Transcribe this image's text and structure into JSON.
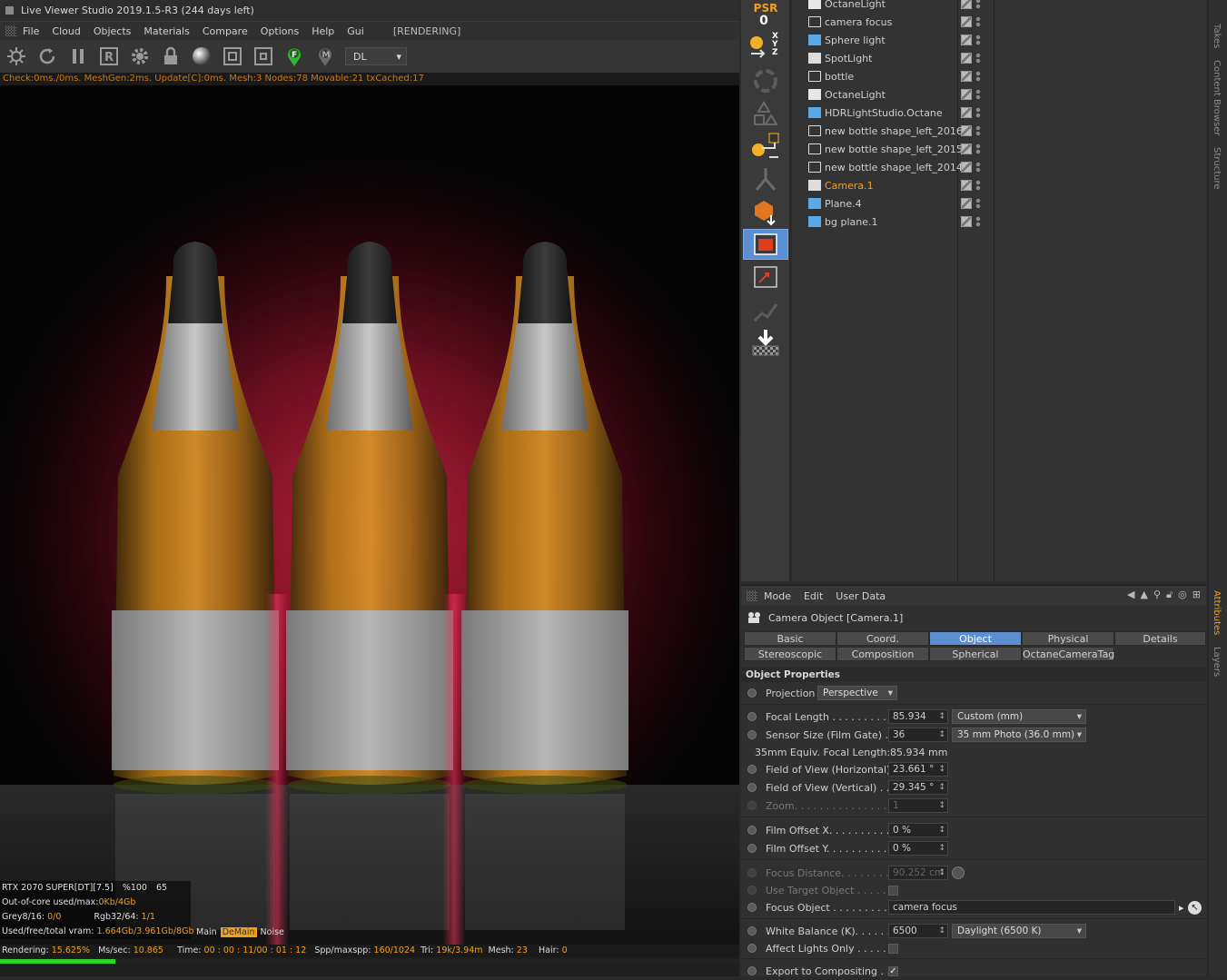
{
  "viewer": {
    "title": "Live Viewer Studio 2019.1.5-R3 (244 days left)",
    "menu": [
      "File",
      "Cloud",
      "Objects",
      "Materials",
      "Compare",
      "Options",
      "Help",
      "Gui"
    ],
    "status": "[RENDERING]",
    "kernel": "DL",
    "check_line": "Check:0ms./0ms. MeshGen:2ms. Update[C]:0ms. Mesh:3 Nodes:78 Movable:21 txCached:17",
    "hud": {
      "gpu": "RTX 2070 SUPER[DT][7.5]",
      "pct": "%100",
      "temp": "65",
      "ooc_label": "Out-of-core used/max:",
      "ooc_value": "0Kb/4Gb",
      "grey_label": "Grey8/16:",
      "grey_value": "0/0",
      "rgb_label": "Rgb32/64:",
      "rgb_value": "1/1",
      "vram_label": "Used/free/total vram:",
      "vram_value": "1.664Gb/3.961Gb/8Gb"
    },
    "channels": [
      "Main",
      "DeMain",
      "Noise"
    ],
    "render_stats": {
      "rendering_label": "Rendering:",
      "rendering_value": "15.625%",
      "ms_label": "Ms/sec:",
      "ms_value": "10.865",
      "time_label": "Time:",
      "time_value": "00 : 00 : 11/00 : 01 : 12",
      "spp_label": "Spp/maxspp:",
      "spp_value": "160/1024",
      "tri_label": "Tri:",
      "tri_value": "19k/3.94m",
      "mesh_label": "Mesh:",
      "mesh_value": "23",
      "hair_label": "Hair:",
      "hair_value": "0"
    },
    "progress": 0.15625
  },
  "palette": {
    "psr_label": "PSR",
    "psr_value": "0",
    "axes": [
      "X",
      "Y",
      "Z"
    ]
  },
  "objects": [
    {
      "name": "OctaneLight",
      "selected": false
    },
    {
      "name": "camera focus",
      "selected": false
    },
    {
      "name": "Sphere light",
      "selected": false
    },
    {
      "name": "SpotLight",
      "selected": false
    },
    {
      "name": "bottle",
      "selected": false
    },
    {
      "name": "OctaneLight",
      "selected": false
    },
    {
      "name": "HDRLightStudio.Octane",
      "selected": false
    },
    {
      "name": "new bottle shape_left_2016",
      "selected": false
    },
    {
      "name": "new bottle shape_left_2015",
      "selected": false
    },
    {
      "name": "new bottle shape_left_2014",
      "selected": false
    },
    {
      "name": "Camera.1",
      "selected": true
    },
    {
      "name": "Plane.4",
      "selected": false
    },
    {
      "name": "bg plane.1",
      "selected": false
    }
  ],
  "side_tabs": [
    "Takes",
    "Content Browser",
    "Structure",
    "Attributes",
    "Layers"
  ],
  "attributes": {
    "menu": [
      "Mode",
      "Edit",
      "User Data"
    ],
    "title": "Camera Object [Camera.1]",
    "tabs_row1": [
      "Basic",
      "Coord.",
      "Object",
      "Physical",
      "Details"
    ],
    "tabs_row2": [
      "Stereoscopic",
      "Composition",
      "Spherical",
      "OctaneCameraTag"
    ],
    "active_tab": "Object",
    "section": "Object Properties",
    "projection_label": "Projection",
    "projection_value": "Perspective",
    "focal_label": "Focal Length . . . . . . . . . . .",
    "focal_value": "85.934",
    "focal_preset": "Custom (mm)",
    "sensor_label": "Sensor Size (Film Gate) . .",
    "sensor_value": "36",
    "sensor_preset": "35 mm Photo (36.0 mm)",
    "equiv_label": "35mm Equiv. Focal Length:",
    "equiv_value": "85.934 mm",
    "fovh_label": "Field of View (Horizontal)",
    "fovh_value": "23.661 °",
    "fovv_label": "Field of View (Vertical) . . .",
    "fovv_value": "29.345 °",
    "zoom_label": "Zoom. . . . . . . . . . . . . . . . . . .",
    "zoom_value": "1",
    "offx_label": "Film Offset X. . . . . . . . . . .",
    "offx_value": "0 %",
    "offy_label": "Film Offset Y. . . . . . . . . . .",
    "offy_value": "0 %",
    "focusdist_label": "Focus Distance. . . . . . . . . .",
    "focusdist_value": "90.252 cm",
    "usetarget_label": "Use Target Object . . . . . .",
    "focusobj_label": "Focus Object . . . . . . . . . . .",
    "focusobj_value": "camera focus",
    "wb_label": "White Balance (K). . . . . . .",
    "wb_value": "6500",
    "wb_preset": "Daylight (6500 K)",
    "affect_label": "Affect Lights Only . . . . . .",
    "export_label": "Export to Compositing . . ."
  }
}
